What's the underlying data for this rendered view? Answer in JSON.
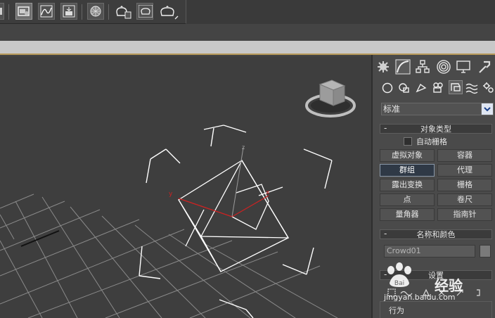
{
  "toolbar": {
    "buttons": [
      "tool-partial-icon",
      "schematic-view-icon",
      "curve-editor-icon",
      "render-setup-icon",
      "material-editor-icon",
      "render-frame-icon",
      "render-icon",
      "active-shade-icon"
    ]
  },
  "command_panel": {
    "tabs": [
      "create-icon",
      "modify-icon",
      "hierarchy-icon",
      "motion-icon",
      "display-icon",
      "utilities-icon"
    ],
    "subtabs": [
      "geometry-icon",
      "shapes-icon",
      "lights-icon",
      "cameras-icon",
      "helpers-icon",
      "spacewarps-icon",
      "systems-icon"
    ],
    "dropdown_value": "标准",
    "object_type": {
      "title": "对象类型",
      "autogrid_label": "自动栅格",
      "buttons": [
        "虚拟对象",
        "容器",
        "群组",
        "代理",
        "露出变换",
        "栅格",
        "点",
        "卷尺",
        "量角器",
        "指南针"
      ],
      "selected": "群组"
    },
    "name_color": {
      "title": "名称和颜色",
      "name_value": "Crowd01"
    },
    "setup": {
      "title": "设置",
      "behavior_label": "行为"
    }
  },
  "viewport": {
    "axis_labels": [
      "x",
      "y",
      "z"
    ]
  },
  "watermark": {
    "text": "经验",
    "url": "jingyan.baidu.com"
  },
  "colors": {
    "viewport_bg": "#3e3e3e",
    "grid": "#8a8a8a",
    "wire": "#ffffff",
    "axis_x": "#cc2222",
    "panel_bg": "#4a4a4a",
    "timeline_accent": "#b89a5a"
  }
}
